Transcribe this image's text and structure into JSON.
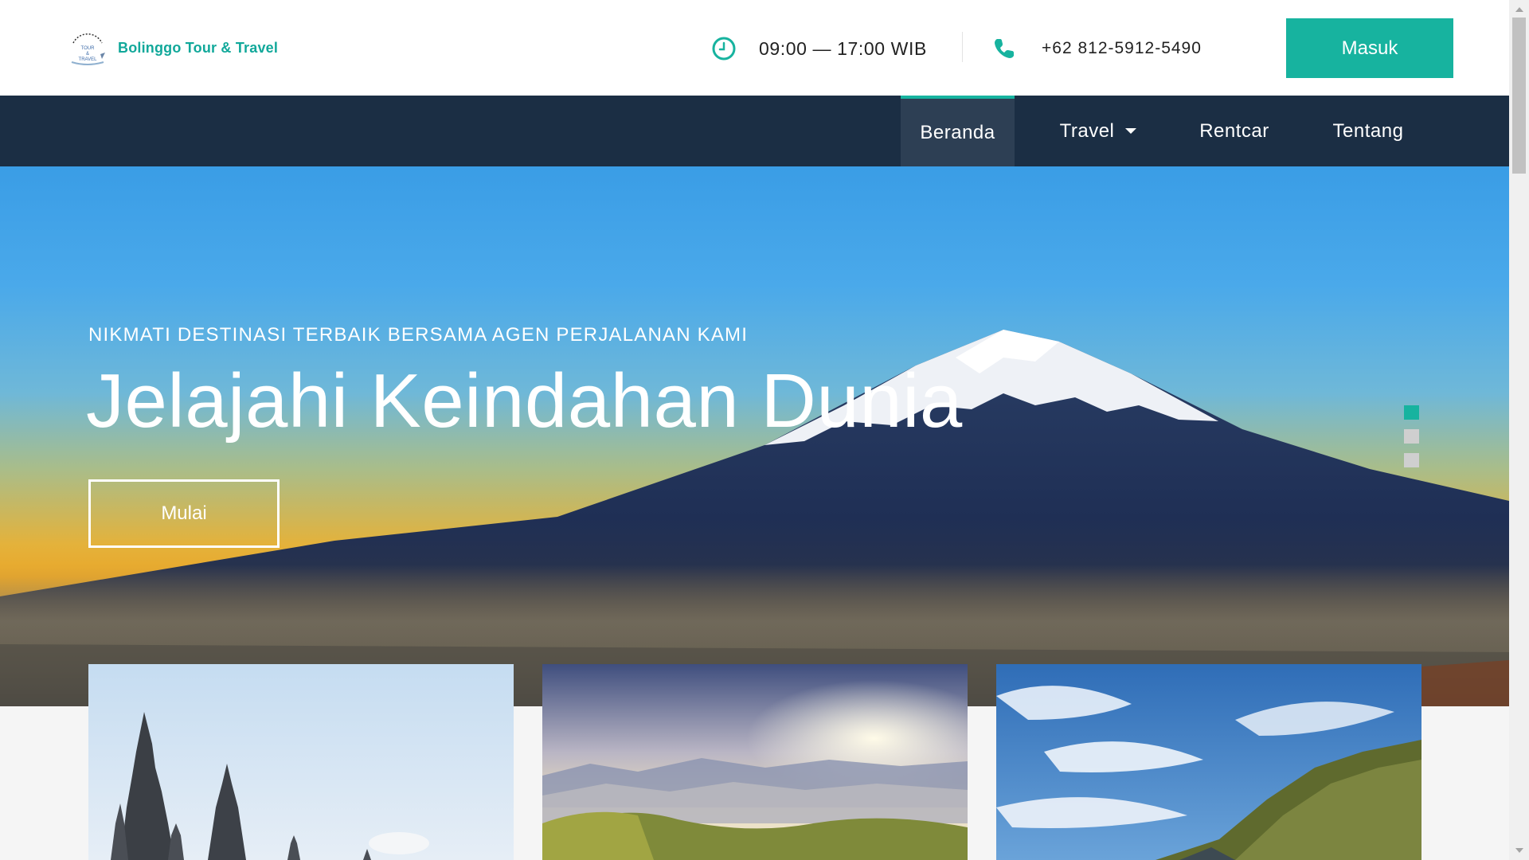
{
  "header": {
    "brand_name": "Bolinggo Tour & Travel",
    "logo_text": "BOLINGGO TOUR & TRAVEL",
    "hours": "09:00 — 17:00 WIB",
    "phone": "+62 812-5912-5490",
    "login_label": "Masuk"
  },
  "nav": {
    "items": [
      {
        "label": "Beranda",
        "active": true
      },
      {
        "label": "Travel",
        "active": false,
        "dropdown": true
      },
      {
        "label": "Rentcar",
        "active": false
      },
      {
        "label": "Tentang",
        "active": false
      }
    ]
  },
  "hero": {
    "subtitle": "NIKMATI DESTINASI TERBAIK BERSAMA AGEN PERJALANAN KAMI",
    "title": "Jelajahi Keindahan Dunia",
    "button_label": "Mulai",
    "slides": 3,
    "active_slide": 1
  },
  "colors": {
    "accent": "#17b39f",
    "nav_bg": "#1b2e44",
    "nav_active_bg": "#2d3f54"
  },
  "icons": {
    "clock": "clock-icon",
    "phone": "phone-icon",
    "caret": "chevron-down-icon"
  }
}
